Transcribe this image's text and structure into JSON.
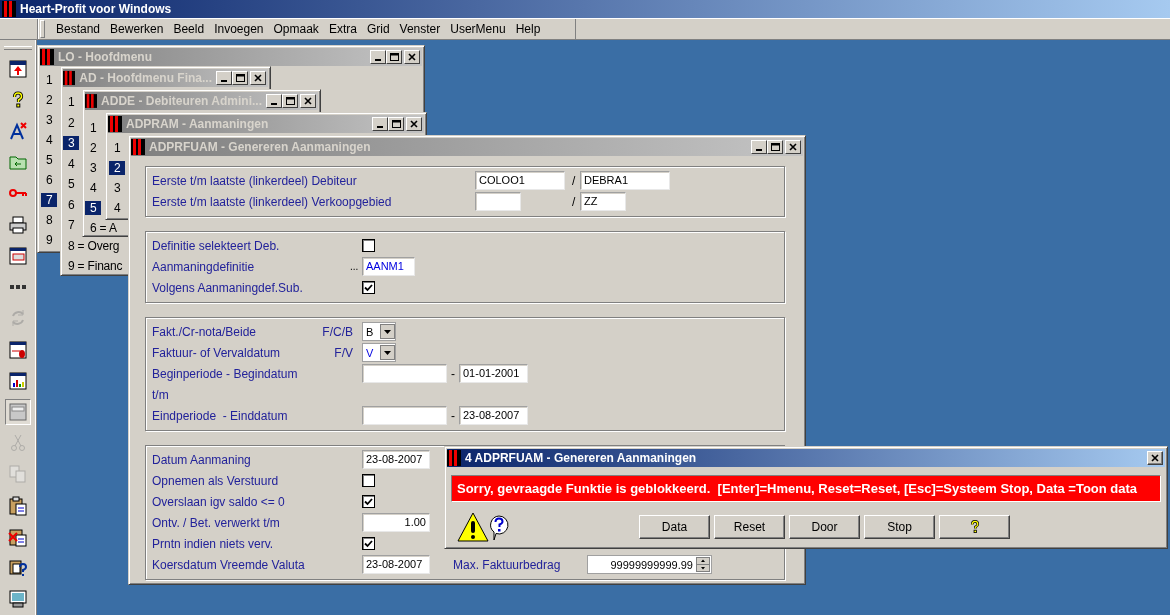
{
  "app": {
    "title": "Heart-Profit voor Windows",
    "active": true
  },
  "menu": [
    {
      "label": "Bestand"
    },
    {
      "label": "Bewerken"
    },
    {
      "label": "Beeld"
    },
    {
      "label": "Invoegen"
    },
    {
      "label": "Opmaak"
    },
    {
      "label": "Extra"
    },
    {
      "label": "Grid"
    },
    {
      "label": "Venster"
    },
    {
      "label": "UserMenu"
    },
    {
      "label": "Help"
    }
  ],
  "toolbar": [
    {
      "kind": "window-up",
      "disabled": false,
      "pressed": false
    },
    {
      "kind": "help",
      "disabled": false,
      "pressed": false
    },
    {
      "kind": "font-delete",
      "disabled": false,
      "pressed": false
    },
    {
      "kind": "folder",
      "disabled": false,
      "pressed": false
    },
    {
      "kind": "key",
      "disabled": false,
      "pressed": false
    },
    {
      "kind": "printer",
      "disabled": false,
      "pressed": false
    },
    {
      "kind": "window-list",
      "disabled": false,
      "pressed": false
    },
    {
      "kind": "dots",
      "disabled": false,
      "pressed": false
    },
    {
      "kind": "refresh",
      "disabled": true,
      "pressed": false
    },
    {
      "kind": "window-mouse",
      "disabled": false,
      "pressed": false
    },
    {
      "kind": "chart",
      "disabled": false,
      "pressed": false
    },
    {
      "kind": "window",
      "disabled": false,
      "pressed": true
    },
    {
      "kind": "scissors",
      "disabled": true,
      "pressed": false
    },
    {
      "kind": "copy",
      "disabled": true,
      "pressed": false
    },
    {
      "kind": "paste",
      "disabled": false,
      "pressed": false
    },
    {
      "kind": "paste-delete",
      "disabled": false,
      "pressed": false
    },
    {
      "kind": "paste-help",
      "disabled": false,
      "pressed": false
    },
    {
      "kind": "monitor",
      "disabled": false,
      "pressed": false
    }
  ],
  "windows": [
    {
      "title": "LO - Hoofdmenu",
      "active": false,
      "items": [
        {
          "label": "1",
          "selected": false
        },
        {
          "label": "2",
          "selected": false
        },
        {
          "label": "3",
          "selected": false
        },
        {
          "label": "4",
          "selected": false
        },
        {
          "label": "5",
          "selected": false
        },
        {
          "label": "6",
          "selected": false
        },
        {
          "label": "7",
          "selected": true
        },
        {
          "label": "8",
          "selected": false
        },
        {
          "label": "9",
          "selected": false
        }
      ]
    },
    {
      "title": "AD - Hoofdmenu Fina...",
      "active": false,
      "items": [
        {
          "label": "1",
          "selected": false
        },
        {
          "label": "2",
          "selected": false
        },
        {
          "label": "3",
          "selected": true
        },
        {
          "label": "4",
          "selected": false
        },
        {
          "label": "5",
          "selected": false
        },
        {
          "label": "6",
          "selected": false
        },
        {
          "label": "7",
          "selected": false
        },
        {
          "label": "8 = Overg",
          "selected": false
        },
        {
          "label": "9 = Financ",
          "selected": false
        }
      ]
    },
    {
      "title": "ADDE - Debiteuren Admini...",
      "active": false,
      "items": [
        {
          "label": "1",
          "selected": false
        },
        {
          "label": "2",
          "selected": false
        },
        {
          "label": "3",
          "selected": false
        },
        {
          "label": "4",
          "selected": false
        },
        {
          "label": "5",
          "selected": true
        },
        {
          "label": "6 = A",
          "selected": false
        }
      ]
    },
    {
      "title": "ADPRAM - Aanmaningen",
      "active": false,
      "items": [
        {
          "label": "1",
          "selected": false
        },
        {
          "label": "2",
          "selected": true
        },
        {
          "label": "3",
          "selected": false
        },
        {
          "label": "4",
          "selected": false
        }
      ]
    }
  ],
  "form_window": {
    "title": "ADPRFUAM - Genereren Aanmaningen",
    "active": false,
    "groups": [
      {
        "rows": [
          {
            "kind": "range",
            "label": "Eerste t/m laatste (linkerdeel) Debiteur",
            "from": "COLOO1",
            "separator": "/",
            "to": "DEBRA1"
          },
          {
            "kind": "range",
            "label": "Eerste t/m laatste (linkerdeel) Verkoopgebied",
            "separator": "/",
            "to": "ZZ"
          }
        ]
      },
      {
        "rows": [
          {
            "kind": "checkbox",
            "label": "Definitie selekteert Deb.",
            "checked": false
          },
          {
            "kind": "lookup",
            "label": "Aanmaningdefinitie",
            "prefix": "...",
            "value": "AANM1",
            "highlighted": true
          },
          {
            "kind": "checkbox",
            "label": "Volgens Aanmaningdef.Sub.",
            "checked": true
          }
        ]
      },
      {
        "rows": [
          {
            "kind": "combo",
            "label": "Fakt./Cr-nota/Beide",
            "code": "F/C/B",
            "value": "B",
            "highlighted": false
          },
          {
            "kind": "combo",
            "label": "Faktuur- of Vervaldatum",
            "code": "F/V",
            "value": "V",
            "highlighted": true
          },
          {
            "kind": "period",
            "label": "Beginperiode - Begindatum",
            "separator": "-",
            "to": "01-01-2001"
          },
          {
            "kind": "text",
            "label": "t/m"
          },
          {
            "kind": "period",
            "label": "Eindperiode  - Einddatum",
            "separator": "-",
            "to": "23-08-2007"
          }
        ]
      },
      {
        "rows": [
          {
            "kind": "field",
            "label": "Datum Aanmaning",
            "value": "23-08-2007"
          },
          {
            "kind": "checkbox",
            "label": "Opnemen als Verstuurd",
            "checked": false
          },
          {
            "kind": "checkbox",
            "label": "Overslaan igv saldo <= 0",
            "checked": true
          },
          {
            "kind": "number",
            "label": "Ontv. / Bet. verwerkt t/m",
            "value": "1.00"
          },
          {
            "kind": "checkbox",
            "label": "Prntn indien niets verv.",
            "checked": true
          },
          {
            "kind": "field",
            "label": "Koersdatum Vreemde Valuta",
            "value": "23-08-2007",
            "extra": {
              "kind": "spinner",
              "label": "Max. Faktuurbedrag",
              "value": "99999999999.99"
            }
          }
        ]
      }
    ]
  },
  "dialog": {
    "title": "4 ADPRFUAM - Genereren Aanmaningen",
    "active": true,
    "message": "Sorry, gevraagde Funktie is geblokkeerd.  [Enter]=Hmenu, Reset=Reset, [Esc]=Systeem Stop, Data =Toon data",
    "buttons": [
      {
        "kind": "text",
        "label": "Data"
      },
      {
        "kind": "text",
        "label": "Reset"
      },
      {
        "kind": "text",
        "label": "Door"
      },
      {
        "kind": "text",
        "label": "Stop"
      },
      {
        "kind": "help"
      }
    ]
  }
}
